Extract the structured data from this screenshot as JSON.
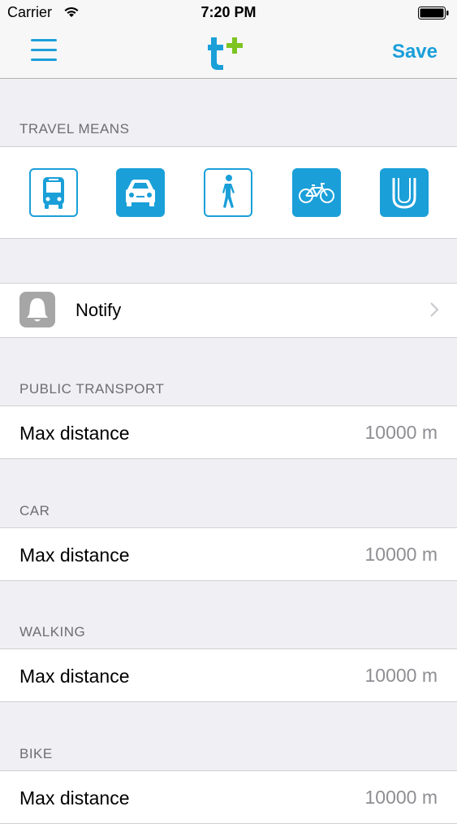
{
  "status": {
    "carrier": "Carrier",
    "time": "7:20 PM"
  },
  "nav": {
    "save_label": "Save"
  },
  "sections": {
    "travel_means": "TRAVEL MEANS",
    "public_transport": "PUBLIC TRANSPORT",
    "car": "CAR",
    "walking": "WALKING",
    "bike": "BIKE"
  },
  "travel_means": [
    {
      "icon": "bus-icon",
      "selected": false
    },
    {
      "icon": "car-icon",
      "selected": true
    },
    {
      "icon": "walk-icon",
      "selected": false
    },
    {
      "icon": "bicycle-icon",
      "selected": true
    },
    {
      "icon": "subway-icon",
      "selected": true
    }
  ],
  "notify": {
    "label": "Notify"
  },
  "rows": {
    "public_transport": {
      "label": "Max distance",
      "value": "10000 m"
    },
    "car": {
      "label": "Max distance",
      "value": "10000 m"
    },
    "walking": {
      "label": "Max distance",
      "value": "10000 m"
    },
    "bike": {
      "label": "Max distance",
      "value": "10000 m"
    }
  },
  "colors": {
    "accent": "#1a9fd9",
    "logo_plus": "#7dc421",
    "background": "#efeff4"
  }
}
